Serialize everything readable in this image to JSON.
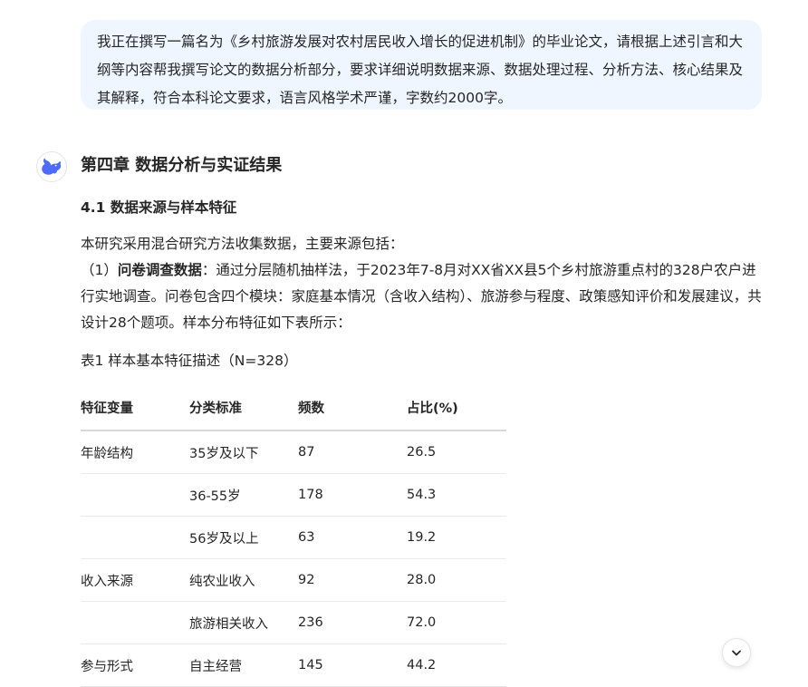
{
  "user_message": "我正在撰写一篇名为《乡村旅游发展对农村居民收入增长的促进机制》的毕业论文，请根据上述引言和大纲等内容帮我撰写论文的数据分析部分，要求详细说明数据来源、数据处理过程、分析方法、核心结果及其解释，符合本科论文要求，语言风格学术严谨，字数约2000字。",
  "answer": {
    "chapter_title": "第四章 数据分析与实证结果",
    "section_title": "4.1 数据来源与样本特征",
    "intro": "本研究采用混合研究方法收集数据，主要来源包括：",
    "item1_prefix": "（1）",
    "item1_bold": "问卷调查数据",
    "item1_text": "：通过分层随机抽样法，于2023年7-8月对XX省XX县5个乡村旅游重点村的328户农户进行实地调查。问卷包含四个模块：家庭基本情况（含收入结构）、旅游参与程度、政策感知评价和发展建议，共设计28个题项。样本分布特征如下表所示：",
    "table_caption": "表1 样本基本特征描述（N=328）",
    "table": {
      "headers": [
        "特征变量",
        "分类标准",
        "频数",
        "占比(%)"
      ],
      "rows": [
        [
          "年龄结构",
          "35岁及以下",
          "87",
          "26.5"
        ],
        [
          "",
          "36-55岁",
          "178",
          "54.3"
        ],
        [
          "",
          "56岁及以上",
          "63",
          "19.2"
        ],
        [
          "收入来源",
          "纯农业收入",
          "92",
          "28.0"
        ],
        [
          "",
          "旅游相关收入",
          "236",
          "72.0"
        ],
        [
          "参与形式",
          "自主经营",
          "145",
          "44.2"
        ]
      ]
    }
  },
  "icons": {
    "avatar": "whale-logo-icon",
    "scroll": "chevron-down-icon"
  },
  "colors": {
    "accent": "#4d6bfe",
    "bubble": "#eff6ff"
  }
}
